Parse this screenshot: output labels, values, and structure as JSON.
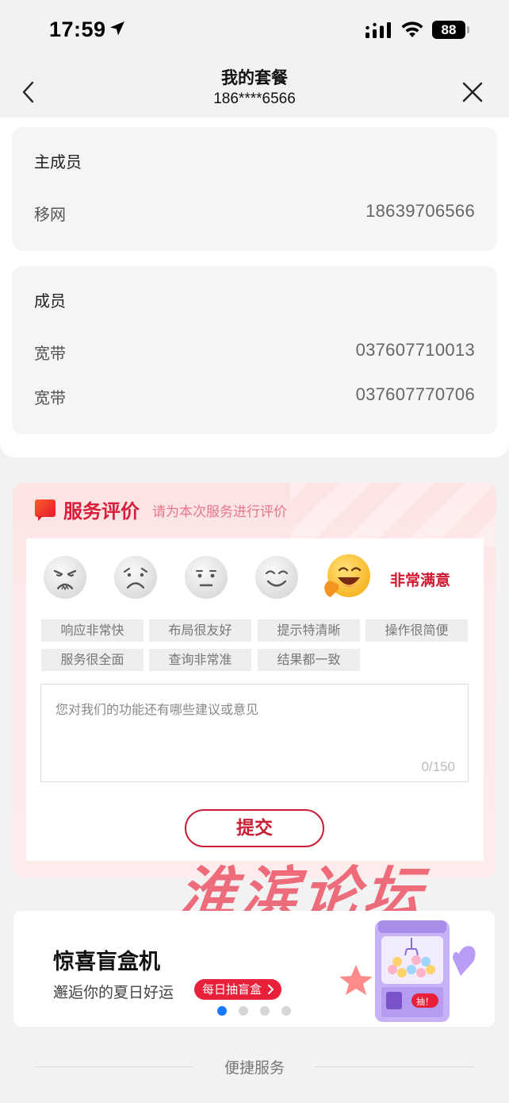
{
  "status_bar": {
    "time": "17:59",
    "battery": "88",
    "icons": [
      "location-arrow-icon",
      "signal-icon",
      "wifi-icon",
      "battery-icon"
    ]
  },
  "nav": {
    "title": "我的套餐",
    "subtitle": "186****6566",
    "icons": [
      "back-icon",
      "close-icon"
    ]
  },
  "main_member": {
    "heading": "主成员",
    "rows": [
      {
        "label": "移网",
        "value": "18639706566"
      }
    ]
  },
  "members": {
    "heading": "成员",
    "rows": [
      {
        "label": "宽带",
        "value": "037607710013"
      },
      {
        "label": "宽带",
        "value": "037607770706"
      }
    ]
  },
  "evaluation": {
    "title": "服务评价",
    "subtitle": "请为本次服务进行评价",
    "faces": [
      "very-unsatisfied",
      "unsatisfied",
      "neutral",
      "satisfied",
      "very-satisfied"
    ],
    "selected_face": "very-satisfied",
    "selected_label": "非常满意",
    "tags": [
      "响应非常快",
      "布局很友好",
      "提示特清晰",
      "操作很简便",
      "服务很全面",
      "查询非常准",
      "结果都一致"
    ],
    "feedback_placeholder": "您对我们的功能还有哪些建议或意见",
    "feedback_count": "0/150",
    "submit_label": "提交",
    "accent_color": "#d0172f"
  },
  "watermark": "淮滨论坛",
  "banner": {
    "title": "惊喜盲盒机",
    "subtitle": "邂逅你的夏日好运",
    "cta": "每日抽盲盒",
    "machine_button": "抽！",
    "dots_total": 4,
    "active_dot": 1
  },
  "quick_services": {
    "title": "便捷服务"
  }
}
